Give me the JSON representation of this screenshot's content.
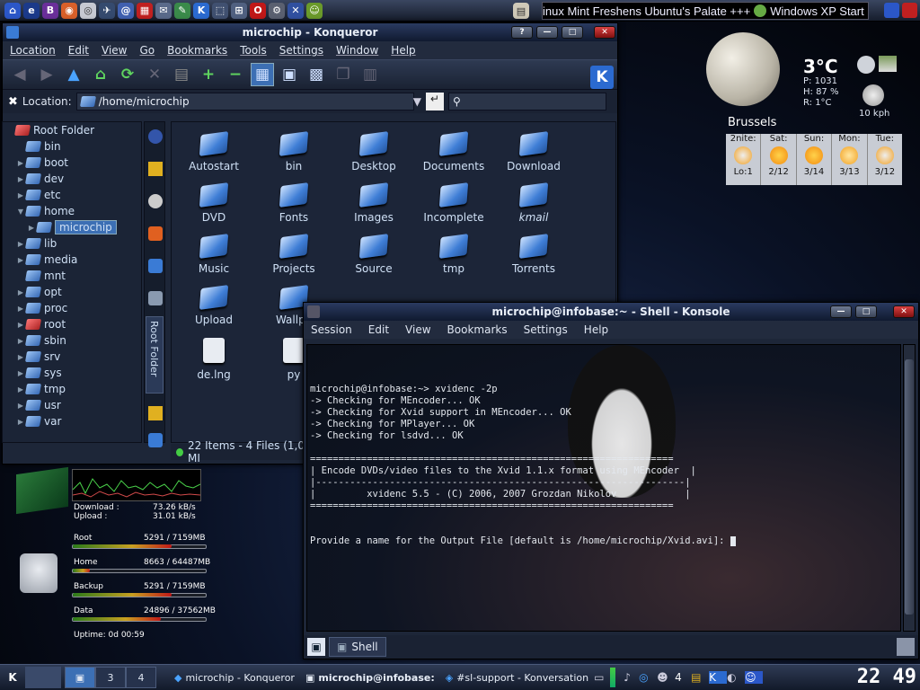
{
  "top_panel": {
    "ticker": "inux Mint Freshens Ubuntu's Palate +++",
    "ticker2": "Windows XP Start"
  },
  "konqueror": {
    "title": "microchip - Konqueror",
    "menu": [
      "Location",
      "Edit",
      "View",
      "Go",
      "Bookmarks",
      "Tools",
      "Settings",
      "Window",
      "Help"
    ],
    "location_label": "Location:",
    "location_value": "/home/microchip",
    "tree": [
      {
        "label": "Root Folder",
        "level": 0,
        "expand": "",
        "red": true
      },
      {
        "label": "bin",
        "level": 1,
        "expand": ""
      },
      {
        "label": "boot",
        "level": 1,
        "expand": "▶"
      },
      {
        "label": "dev",
        "level": 1,
        "expand": "▶"
      },
      {
        "label": "etc",
        "level": 1,
        "expand": "▶"
      },
      {
        "label": "home",
        "level": 1,
        "expand": "▼"
      },
      {
        "label": "microchip",
        "level": 2,
        "expand": "▶",
        "selected": true
      },
      {
        "label": "lib",
        "level": 1,
        "expand": "▶"
      },
      {
        "label": "media",
        "level": 1,
        "expand": "▶"
      },
      {
        "label": "mnt",
        "level": 1,
        "expand": ""
      },
      {
        "label": "opt",
        "level": 1,
        "expand": "▶"
      },
      {
        "label": "proc",
        "level": 1,
        "expand": "▶"
      },
      {
        "label": "root",
        "level": 1,
        "expand": "▶",
        "red": true
      },
      {
        "label": "sbin",
        "level": 1,
        "expand": "▶"
      },
      {
        "label": "srv",
        "level": 1,
        "expand": "▶"
      },
      {
        "label": "sys",
        "level": 1,
        "expand": "▶"
      },
      {
        "label": "tmp",
        "level": 1,
        "expand": "▶"
      },
      {
        "label": "usr",
        "level": 1,
        "expand": "▶"
      },
      {
        "label": "var",
        "level": 1,
        "expand": "▶"
      }
    ],
    "vtab_label": "Root Folder",
    "files": [
      {
        "name": "Autostart"
      },
      {
        "name": "bin"
      },
      {
        "name": "Desktop"
      },
      {
        "name": "Documents"
      },
      {
        "name": "Download"
      },
      {
        "name": "DVD"
      },
      {
        "name": "Fonts"
      },
      {
        "name": "Images"
      },
      {
        "name": "Incomplete"
      },
      {
        "name": "kmail",
        "italic": true
      },
      {
        "name": "Music"
      },
      {
        "name": "Projects"
      },
      {
        "name": "Source"
      },
      {
        "name": "tmp"
      },
      {
        "name": "Torrents"
      },
      {
        "name": "Upload"
      },
      {
        "name": "Wallpa"
      },
      {
        "name": "de.lng",
        "doc": true
      },
      {
        "name": "py",
        "doc": true
      }
    ],
    "status": "22 Items - 4 Files (1,0 MI"
  },
  "konsole": {
    "title": "microchip@infobase:~ - Shell - Konsole",
    "menu": [
      "Session",
      "Edit",
      "View",
      "Bookmarks",
      "Settings",
      "Help"
    ],
    "lines": [
      "microchip@infobase:~> xvidenc -2p",
      "-> Checking for MEncoder... OK",
      "-> Checking for Xvid support in MEncoder... OK",
      "-> Checking for MPlayer... OK",
      "-> Checking for lsdvd... OK",
      "",
      "================================================================",
      "| Encode DVDs/video files to the Xvid 1.1.x format using MEncoder  |",
      "|-----------------------------------------------------------------|",
      "|         xvidenc 5.5 - (C) 2006, 2007 Grozdan Nikolov            |",
      "================================================================",
      "",
      "",
      "Provide a name for the Output File [default is /home/microchip/Xvid.avi]: "
    ],
    "tab": "Shell"
  },
  "weather": {
    "temp": "3°C",
    "pressure": "P: 1031",
    "humidity": "H: 87 %",
    "realfeel": "R: 1°C",
    "wind": "10 kph",
    "city": "Brussels",
    "days": [
      {
        "name": "2nite:",
        "val": "Lo:1"
      },
      {
        "name": "Sat:",
        "val": "2/12"
      },
      {
        "name": "Sun:",
        "val": "3/14"
      },
      {
        "name": "Mon:",
        "val": "3/13"
      },
      {
        "name": "Tue:",
        "val": "3/12"
      }
    ]
  },
  "monitor": {
    "download_label": "Download :",
    "download": "73.26 kB/s",
    "upload_label": "Upload :",
    "upload": "31.01 kB/s",
    "disks": [
      {
        "name": "Root",
        "value": "5291 / 7159MB",
        "fill": 0.74
      },
      {
        "name": "Home",
        "value": "8663 / 64487MB",
        "fill": 0.13
      },
      {
        "name": "Backup",
        "value": "5291 / 7159MB",
        "fill": 0.74
      },
      {
        "name": "Data",
        "value": "24896 / 37562MB",
        "fill": 0.66
      }
    ],
    "uptime": "Uptime: 0d 00:59"
  },
  "taskbar": {
    "desktops": [
      "3",
      "4"
    ],
    "tasks": [
      "microchip - Konqueror",
      "microchip@infobase:",
      "#sl-support - Konversation"
    ],
    "tray_num": "4",
    "clock": "22 49"
  }
}
